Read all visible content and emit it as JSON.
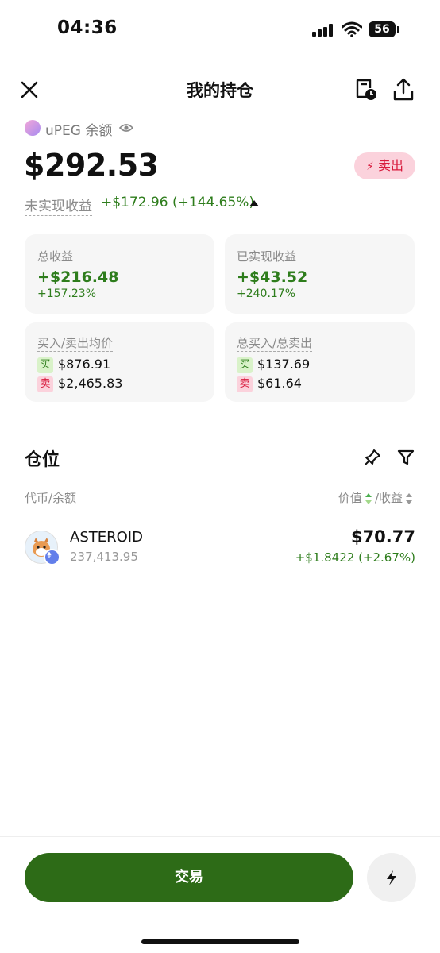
{
  "status_bar": {
    "time": "04:36",
    "battery": "56"
  },
  "header": {
    "title": "我的持仓"
  },
  "token": {
    "symbol": "uPEG",
    "balance_label": "余额"
  },
  "balance": "$292.53",
  "sell_label": "卖出",
  "unrealized": {
    "label": "未实现收益",
    "value": "+$172.96 (+144.65%)"
  },
  "cards": {
    "total_pnl": {
      "label": "总收益",
      "value": "+$216.48",
      "pct": "+157.23%"
    },
    "realized_pnl": {
      "label": "已实现收益",
      "value": "+$43.52",
      "pct": "+240.17%"
    },
    "avg_price": {
      "label": "买入/卖出均价",
      "buy_tag": "买",
      "buy": "$876.91",
      "sell_tag": "卖",
      "sell": "$2,465.83"
    },
    "totals": {
      "label": "总买入/总卖出",
      "buy_tag": "买",
      "buy": "$137.69",
      "sell_tag": "卖",
      "sell": "$61.64"
    }
  },
  "positions": {
    "title": "仓位",
    "col_left": "代币/余额",
    "col_value": "价值",
    "col_pnl": "/收益",
    "items": [
      {
        "name": "ASTEROID",
        "amount": "237,413.95",
        "value": "$70.77",
        "pnl": "+$1.8422 (+2.67%)"
      }
    ]
  },
  "trade_button": "交易",
  "colors": {
    "green": "#2e7d1c",
    "button_green": "#2d6b17",
    "sell_red": "#d81b3d",
    "sell_bg": "#fbd2dc"
  }
}
